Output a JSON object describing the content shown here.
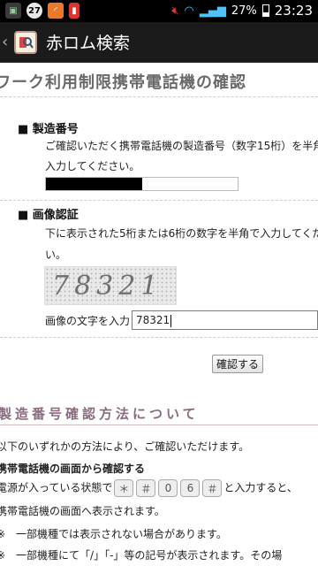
{
  "status": {
    "notification_count": "27",
    "battery": "27%",
    "time": "23:23"
  },
  "actionbar": {
    "title": "赤ロム検索"
  },
  "page": {
    "heading": "ワーク利用制限携帯電話機の確認"
  },
  "serial": {
    "title": "■ 製造番号",
    "desc1": "ご確認いただく携帯電話機の製造番号（数字15桁）を半角",
    "desc2": "入力してください。",
    "progress": 0.5
  },
  "captcha": {
    "title": "■ 画像認証",
    "desc1": "下に表示された5桁または6桁の数字を半角で入力してくだ",
    "desc2": "い。",
    "image_text": "78321",
    "input_label": "画像の文字を入力",
    "input_value": "78321"
  },
  "confirm_button": "確認する",
  "howto": {
    "heading": "製造番号確認方法について",
    "line1": "以下のいずれかの方法により、ご確認いただけます。",
    "subheading": "携帯電話機の画面から確認する",
    "line2_pre": "電源が入っている状態で",
    "keys": [
      "＊",
      "＃",
      "0",
      "6",
      "＃"
    ],
    "line2_post": "と入力すると、",
    "line3": "携帯電話機の画面へ表示されます。",
    "note1": "※　一部機種では表示されない場合があります。",
    "note2": "※　一部機種にて「/」「-」等の記号が表示されます。その場"
  }
}
